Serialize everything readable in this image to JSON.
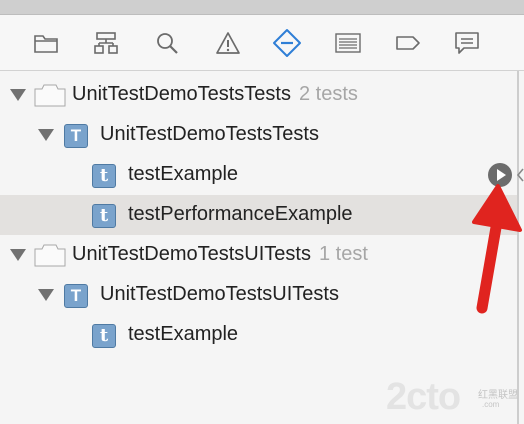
{
  "toolbar": {
    "icons": [
      "folder-icon",
      "hierarchy-icon",
      "search-icon",
      "warning-icon",
      "test-navigator-icon",
      "debug-list-icon",
      "breakpoint-icon",
      "report-icon"
    ],
    "active_icon": "test-navigator-icon",
    "accent_color": "#2f7fd6"
  },
  "tree": {
    "bundle1": {
      "name": "UnitTestDemoTestsTests",
      "count": "2 tests"
    },
    "class1": {
      "badge": "T",
      "name": "UnitTestDemoTestsTests"
    },
    "test1": {
      "badge": "t",
      "name": "testExample"
    },
    "test2": {
      "badge": "t",
      "name": "testPerformanceExample",
      "selected": true
    },
    "bundle2": {
      "name": "UnitTestDemoTestsUITests",
      "count": "1 test"
    },
    "class2": {
      "badge": "T",
      "name": "UnitTestDemoTestsUITests"
    },
    "test3": {
      "badge": "t",
      "name": "testExample"
    }
  },
  "annotation": {
    "arrow_color": "#e0241f"
  },
  "watermark": {
    "logo": "2cto",
    "tagline": "红黑联盟",
    "url": ".com"
  }
}
